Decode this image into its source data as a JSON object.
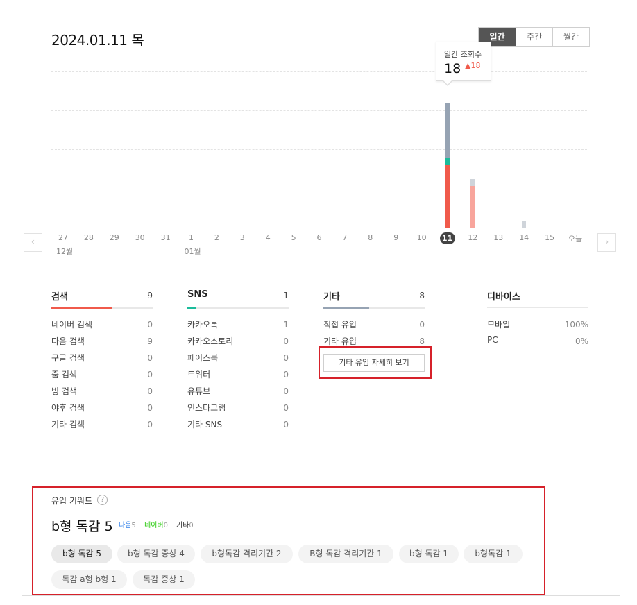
{
  "header": {
    "date": "2024.01.11 목"
  },
  "period_tabs": [
    {
      "label": "일간",
      "active": true
    },
    {
      "label": "주간",
      "active": false
    },
    {
      "label": "월간",
      "active": false
    }
  ],
  "tooltip": {
    "label": "일간 조회수",
    "value": "18",
    "delta": "18"
  },
  "colors": {
    "accent_red": "#f05a4b",
    "bar_gray": "#96a3b3",
    "teal": "#1bbc9b",
    "selected_dark": "#444444",
    "highlight_red": "#d6212a"
  },
  "chart_data": {
    "type": "bar",
    "categories": [
      "27",
      "28",
      "29",
      "30",
      "31",
      "1",
      "2",
      "3",
      "4",
      "5",
      "6",
      "7",
      "8",
      "9",
      "10",
      "11",
      "12",
      "13",
      "14",
      "15",
      "오늘"
    ],
    "series": [
      {
        "name": "검색",
        "values": [
          0,
          0,
          0,
          0,
          0,
          0,
          0,
          0,
          0,
          0,
          0,
          0,
          0,
          0,
          0,
          9,
          6,
          0,
          0,
          0,
          0
        ]
      },
      {
        "name": "SNS",
        "values": [
          0,
          0,
          0,
          0,
          0,
          0,
          0,
          0,
          0,
          0,
          0,
          0,
          0,
          0,
          0,
          1,
          0,
          0,
          0,
          0,
          0
        ]
      },
      {
        "name": "기타",
        "values": [
          0,
          0,
          0,
          0,
          0,
          0,
          0,
          0,
          0,
          0,
          0,
          0,
          0,
          0,
          0,
          8,
          1,
          0,
          1,
          0,
          0
        ]
      }
    ],
    "selected": "11",
    "month_labels": [
      {
        "at": "27",
        "label": "12월"
      },
      {
        "at": "1",
        "label": "01월"
      }
    ],
    "ylim": [
      0,
      20
    ],
    "grid": true
  },
  "nav": {
    "prev_icon": "‹",
    "next_icon": "›"
  },
  "columns": {
    "search": {
      "title": "검색",
      "count": "9",
      "fill": 0.6,
      "rows": [
        {
          "label": "네이버 검색",
          "value": "0"
        },
        {
          "label": "다음 검색",
          "value": "9"
        },
        {
          "label": "구글 검색",
          "value": "0"
        },
        {
          "label": "줌 검색",
          "value": "0"
        },
        {
          "label": "빙 검색",
          "value": "0"
        },
        {
          "label": "야후 검색",
          "value": "0"
        },
        {
          "label": "기타 검색",
          "value": "0"
        }
      ]
    },
    "sns": {
      "title": "SNS",
      "count": "1",
      "fill": 0.08,
      "rows": [
        {
          "label": "카카오톡",
          "value": "1"
        },
        {
          "label": "카카오스토리",
          "value": "0"
        },
        {
          "label": "페이스북",
          "value": "0"
        },
        {
          "label": "트위터",
          "value": "0"
        },
        {
          "label": "유튜브",
          "value": "0"
        },
        {
          "label": "인스타그램",
          "value": "0"
        },
        {
          "label": "기타 SNS",
          "value": "0"
        }
      ]
    },
    "etc": {
      "title": "기타",
      "count": "8",
      "fill": 0.45,
      "rows": [
        {
          "label": "직접 유입",
          "value": "0"
        },
        {
          "label": "기타 유입",
          "value": "8"
        }
      ],
      "detail_button": "기타 유입 자세히 보기"
    },
    "device": {
      "title": "디바이스",
      "rows": [
        {
          "label": "모바일",
          "value": "100%"
        },
        {
          "label": "PC",
          "value": "0%"
        }
      ]
    }
  },
  "keywords": {
    "title": "유입 키워드",
    "help_icon": "?",
    "main_keyword": "b형 독감 5",
    "sources": [
      {
        "name": "다음",
        "count": "5",
        "color": "#2b7de9"
      },
      {
        "name": "네이버",
        "count": "0",
        "color": "#1ec800"
      },
      {
        "name": "기타",
        "count": "0",
        "color": "#333333"
      }
    ],
    "chips": [
      "b형 독감 5",
      "b형 독감 증상 4",
      "b형독감 격리기간 2",
      "B형 독감 격리기간 1",
      "b형 독감 1",
      "b형독감 1",
      "독감 a형 b형 1",
      "독감 증상 1"
    ]
  }
}
